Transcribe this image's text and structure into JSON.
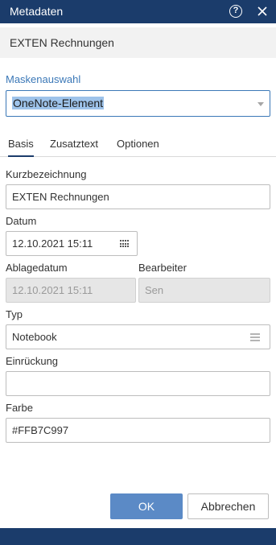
{
  "window": {
    "title": "Metadaten",
    "help_icon": "help-icon",
    "close_icon": "close-icon"
  },
  "document": {
    "title": "EXTEN Rechnungen"
  },
  "mask": {
    "label": "Maskenauswahl",
    "selected": "OneNote-Element"
  },
  "tabs": [
    {
      "label": "Basis",
      "active": true
    },
    {
      "label": "Zusatztext",
      "active": false
    },
    {
      "label": "Optionen",
      "active": false
    }
  ],
  "fields": {
    "kurzbezeichnung": {
      "label": "Kurzbezeichnung",
      "value": "EXTEN Rechnungen"
    },
    "datum": {
      "label": "Datum",
      "value": "12.10.2021 15:11"
    },
    "ablagedatum": {
      "label": "Ablagedatum",
      "value": "12.10.2021 15:11"
    },
    "bearbeiter": {
      "label": "Bearbeiter",
      "value": "Sen"
    },
    "typ": {
      "label": "Typ",
      "value": "Notebook"
    },
    "einrueckung": {
      "label": "Einrückung",
      "value": ""
    },
    "farbe": {
      "label": "Farbe",
      "value": "#FFB7C997"
    }
  },
  "buttons": {
    "ok": "OK",
    "cancel": "Abbrechen"
  },
  "colors": {
    "header": "#1b3c6b",
    "accent": "#3b78b7",
    "primary_button": "#5b8ac6",
    "selection": "#9ec3ea"
  }
}
